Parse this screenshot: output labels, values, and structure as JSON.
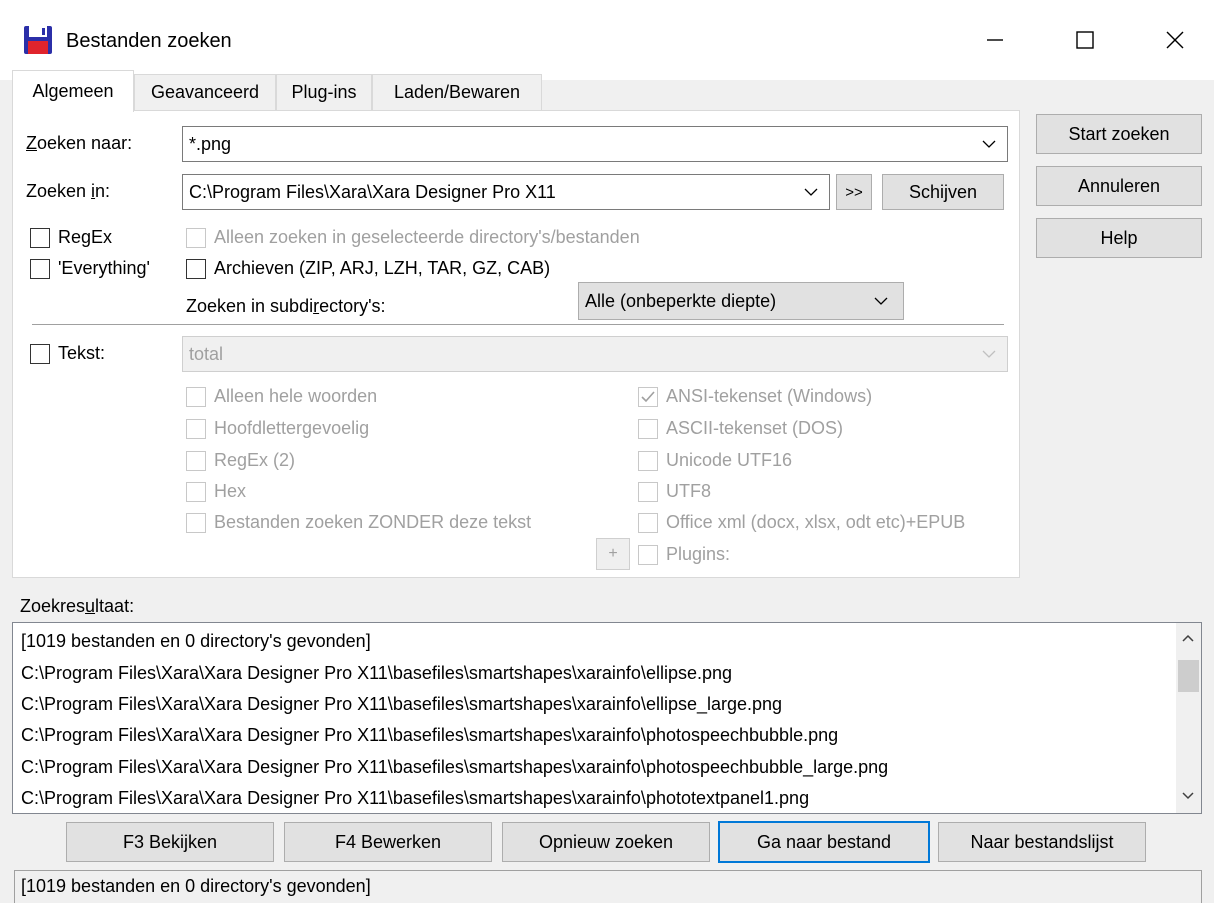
{
  "window": {
    "title": "Bestanden zoeken",
    "icon": "floppy-disk-icon",
    "controls": {
      "minimize": "minimize-icon",
      "maximize": "maximize-icon",
      "close": "close-icon"
    }
  },
  "tabs": [
    {
      "label": "Algemeen",
      "active": true
    },
    {
      "label": "Geavanceerd",
      "active": false
    },
    {
      "label": "Plug-ins",
      "active": false
    },
    {
      "label": "Laden/Bewaren",
      "active": false
    }
  ],
  "search": {
    "for_label_pre": "Z",
    "for_label_post": "oeken naar:",
    "for_value": "*.png",
    "in_label_pre": "Zoeken ",
    "in_label_u": "i",
    "in_label_post": "n:",
    "in_value": "C:\\Program Files\\Xara\\Xara Designer Pro X11",
    "browse_button": ">>",
    "drives_button": "Schijven",
    "regex_label": "RegEx",
    "regex_checked": false,
    "only_selected_label": "Alleen zoeken in geselecteerde directory's/bestanden",
    "everything_label": "'Everything'",
    "everything_checked": false,
    "archives_label": "Archieven (ZIP, ARJ, LZH, TAR, GZ, CAB)",
    "archives_checked": false,
    "subdirs_label_pre": "Zoeken in subdi",
    "subdirs_label_u": "r",
    "subdirs_label_post": "ectory's:",
    "subdirs_value": "Alle (onbeperkte diepte)"
  },
  "text_search": {
    "label": "Tekst:",
    "checked": false,
    "value": "total",
    "options_left": [
      {
        "label": "Alleen hele woorden",
        "checked": false
      },
      {
        "label": "Hoofdlettergevoelig",
        "checked": false
      },
      {
        "label": "RegEx (2)",
        "checked": false
      },
      {
        "label": "Hex",
        "checked": false
      },
      {
        "label": "Bestanden zoeken ZONDER deze tekst",
        "checked": false
      }
    ],
    "options_right": [
      {
        "label": "ANSI-tekenset (Windows)",
        "checked": true
      },
      {
        "label": "ASCII-tekenset (DOS)",
        "checked": false
      },
      {
        "label": "Unicode UTF16",
        "checked": false
      },
      {
        "label": "UTF8",
        "checked": false
      },
      {
        "label": "Office xml (docx, xlsx, odt etc)+EPUB",
        "checked": false
      },
      {
        "label": "Plugins:",
        "checked": false
      }
    ],
    "plus_button": "+"
  },
  "side_buttons": {
    "start": "Start zoeken",
    "cancel": "Annuleren",
    "help": "Help"
  },
  "results": {
    "label_pre": "Zoekres",
    "label_u": "u",
    "label_post": "ltaat:",
    "rows": [
      " [1019 bestanden en 0 directory's gevonden]",
      "C:\\Program Files\\Xara\\Xara Designer Pro X11\\basefiles\\smartshapes\\xarainfo\\ellipse.png",
      "C:\\Program Files\\Xara\\Xara Designer Pro X11\\basefiles\\smartshapes\\xarainfo\\ellipse_large.png",
      "C:\\Program Files\\Xara\\Xara Designer Pro X11\\basefiles\\smartshapes\\xarainfo\\photospeechbubble.png",
      "C:\\Program Files\\Xara\\Xara Designer Pro X11\\basefiles\\smartshapes\\xarainfo\\photospeechbubble_large.png",
      "C:\\Program Files\\Xara\\Xara Designer Pro X11\\basefiles\\smartshapes\\xarainfo\\phototextpanel1.png"
    ]
  },
  "bottom_buttons": {
    "view": "F3 Bekijken",
    "edit": "F4 Bewerken",
    "new_search": "Opnieuw zoeken",
    "goto_file": "Ga naar bestand",
    "to_filelist": "Naar bestandslijst"
  },
  "status": "[1019 bestanden en 0 directory's gevonden]",
  "colors": {
    "focus": "#0078d7",
    "disabled_text": "#a0a0a0",
    "window_bg": "#f0f0f0"
  }
}
